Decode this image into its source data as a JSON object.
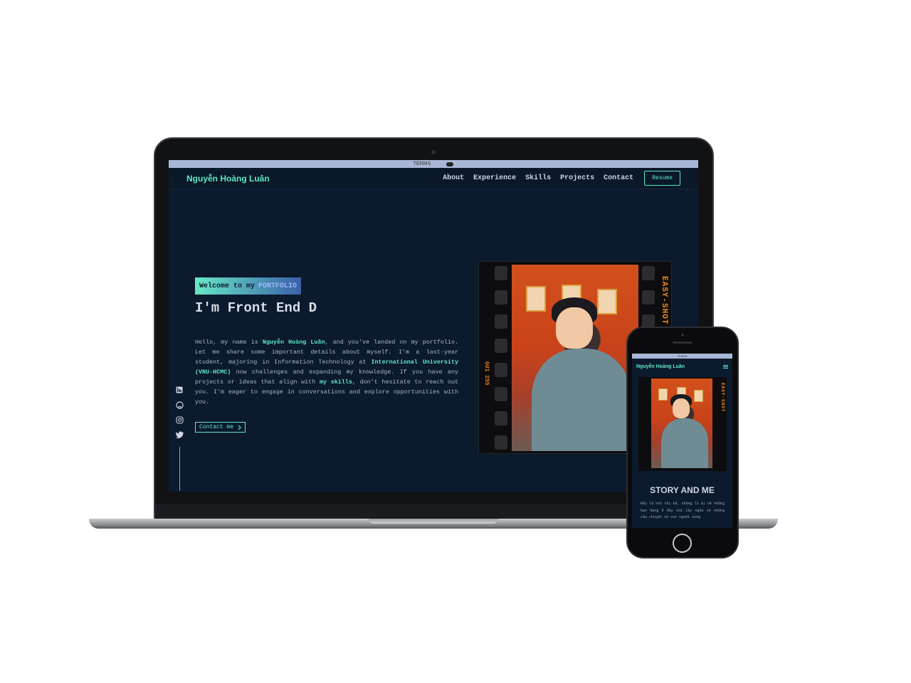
{
  "laptop": {
    "os_bar": {
      "label": "TERMS"
    },
    "nav": {
      "brand": "Nguyễn Hoàng Luân",
      "links": [
        "About",
        "Experience",
        "Skills",
        "Projects",
        "Contact"
      ],
      "resume_label": "Resume"
    },
    "hero": {
      "badge_text": "Welcome to my",
      "badge_highlight": "PORTFOLIO",
      "title": "I'm Front End D",
      "desc_part1": "Hello, my name is ",
      "desc_name": "Nguyễn Hoàng Luân",
      "desc_part2": ", and you've landed on my portfolio. Let me share some important details about myself. I'm a last-year student, majoring in Information Technology at ",
      "desc_university": "International University (VNU-HCMC)",
      "desc_part3": " now challenges and expanding my knowledge. If you have any projects or ideas that align with ",
      "desc_skills": "my skills",
      "desc_part4": ", don't hesitate to reach out you. I'm eager to engage in conversations and explore opportunities with you.",
      "contact_label": "Contact me"
    },
    "social_icons": [
      "linkedin-icon",
      "github-icon",
      "instagram-icon",
      "twitter-icon"
    ],
    "film": {
      "code": "GU1 255",
      "stripe": "EASY-SHOT"
    }
  },
  "phone": {
    "os_label": "TERMS",
    "brand": "Nguyễn Hoàng Luân",
    "heading": "STORY AND ME",
    "text": "Đây là nơi tôi kể, những lí ai về những bạn đang ở đây nơi tây nghe về những câu chuyện và con người xung"
  },
  "colors": {
    "accent": "#5ee8c6",
    "background": "#0c1a2e",
    "text": "#cfd6e4"
  }
}
